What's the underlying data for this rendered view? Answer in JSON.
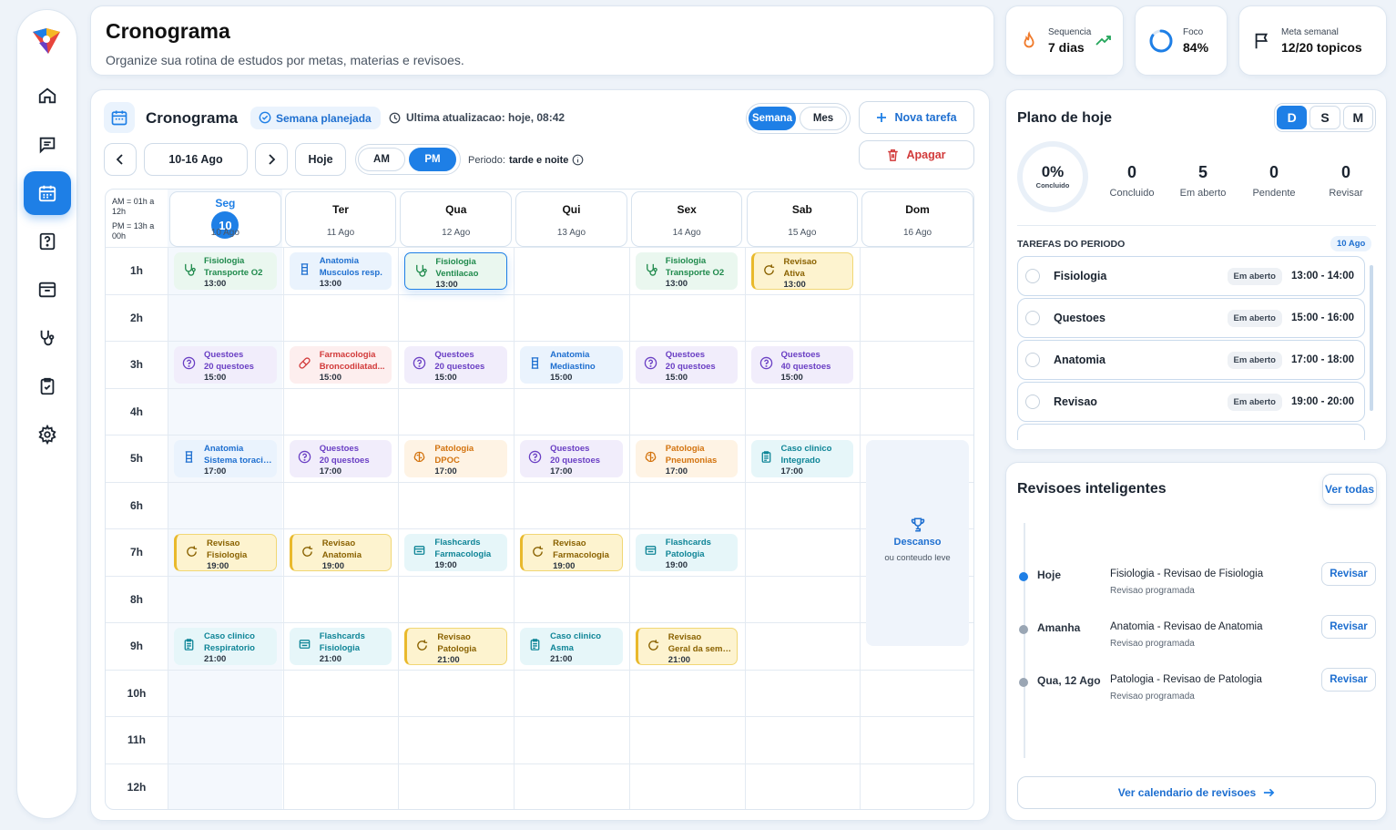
{
  "sidebar": {
    "items": [
      "home",
      "messages",
      "calendar",
      "questions",
      "inbox",
      "stethoscope",
      "checklist",
      "settings"
    ],
    "active": "calendar"
  },
  "header": {
    "title": "Cronograma",
    "subtitle": "Organize sua rotina de estudos por metas, materias e revisoes."
  },
  "stats": [
    {
      "label": "Sequencia",
      "value": "7 dias",
      "icon": "flame-icon"
    },
    {
      "label": "Foco",
      "value": "84%",
      "icon": "progress-ring-icon",
      "fraction": 0.84
    },
    {
      "label": "Meta semanal",
      "value": "12/20 topicos",
      "icon": "flag-icon"
    }
  ],
  "schedule": {
    "title": "Cronograma",
    "badge": "Semana planejada",
    "updated": "Ultima atualizacao: hoje, 08:42",
    "view_week": "Semana",
    "view_month": "Mes",
    "new_task": "Nova tarefa",
    "delete": "Apagar",
    "range": "10-16 Ago",
    "today": "Hoje",
    "am": "AM",
    "pm": "PM",
    "period_label": "Periodo:",
    "period_value": "tarde e noite",
    "legend_am": "AM = 01h a 12h",
    "legend_pm": "PM = 13h a 00h",
    "today_num": "10",
    "days": [
      {
        "name": "Seg",
        "date": "10 Ago"
      },
      {
        "name": "Ter",
        "date": "11 Ago"
      },
      {
        "name": "Qua",
        "date": "12 Ago"
      },
      {
        "name": "Qui",
        "date": "13 Ago"
      },
      {
        "name": "Sex",
        "date": "14 Ago"
      },
      {
        "name": "Sab",
        "date": "15 Ago"
      },
      {
        "name": "Dom",
        "date": "16 Ago"
      }
    ],
    "hours": [
      "1h",
      "2h",
      "3h",
      "4h",
      "5h",
      "6h",
      "7h",
      "8h",
      "9h",
      "10h",
      "11h",
      "12h"
    ],
    "events": [
      {
        "day": 0,
        "hour": 0,
        "title": "Fisiologia",
        "sub": "Transporte O2",
        "time": "13:00",
        "color": "green",
        "icon": "stethoscope-icon"
      },
      {
        "day": 1,
        "hour": 0,
        "title": "Anatomia",
        "sub": "Musculos resp.",
        "time": "13:00",
        "color": "blue",
        "icon": "anatomy-icon"
      },
      {
        "day": 2,
        "hour": 0,
        "title": "Fisiologia",
        "sub": "Ventilacao",
        "time": "13:00",
        "color": "green",
        "icon": "stethoscope-icon",
        "selected": true
      },
      {
        "day": 4,
        "hour": 0,
        "title": "Fisiologia",
        "sub": "Transporte O2",
        "time": "13:00",
        "color": "green",
        "icon": "stethoscope-icon"
      },
      {
        "day": 5,
        "hour": 0,
        "title": "Revisao",
        "sub": "Ativa",
        "time": "13:00",
        "color": "yellow",
        "icon": "refresh-icon"
      },
      {
        "day": 0,
        "hour": 2,
        "title": "Questoes",
        "sub": "20 questoes",
        "time": "15:00",
        "color": "purple",
        "icon": "question-icon"
      },
      {
        "day": 1,
        "hour": 2,
        "title": "Farmacologia",
        "sub": "Broncodilatad...",
        "time": "15:00",
        "color": "red",
        "icon": "pill-icon"
      },
      {
        "day": 2,
        "hour": 2,
        "title": "Questoes",
        "sub": "20 questoes",
        "time": "15:00",
        "color": "purple",
        "icon": "question-icon"
      },
      {
        "day": 3,
        "hour": 2,
        "title": "Anatomia",
        "sub": "Mediastino",
        "time": "15:00",
        "color": "blue",
        "icon": "anatomy-icon"
      },
      {
        "day": 4,
        "hour": 2,
        "title": "Questoes",
        "sub": "20 questoes",
        "time": "15:00",
        "color": "purple",
        "icon": "question-icon"
      },
      {
        "day": 5,
        "hour": 2,
        "title": "Questoes",
        "sub": "40 questoes",
        "time": "15:00",
        "color": "purple",
        "icon": "question-icon"
      },
      {
        "day": 0,
        "hour": 4,
        "title": "Anatomia",
        "sub": "Sistema toracico",
        "time": "17:00",
        "color": "blue",
        "icon": "anatomy-icon"
      },
      {
        "day": 1,
        "hour": 4,
        "title": "Questoes",
        "sub": "20 questoes",
        "time": "17:00",
        "color": "purple",
        "icon": "question-icon"
      },
      {
        "day": 2,
        "hour": 4,
        "title": "Patologia",
        "sub": "DPOC",
        "time": "17:00",
        "color": "orange",
        "icon": "brain-icon"
      },
      {
        "day": 3,
        "hour": 4,
        "title": "Questoes",
        "sub": "20 questoes",
        "time": "17:00",
        "color": "purple",
        "icon": "question-icon"
      },
      {
        "day": 4,
        "hour": 4,
        "title": "Patologia",
        "sub": "Pneumonias",
        "time": "17:00",
        "color": "orange",
        "icon": "brain-icon"
      },
      {
        "day": 5,
        "hour": 4,
        "title": "Caso clinico",
        "sub": "Integrado",
        "time": "17:00",
        "color": "teal",
        "icon": "clipboard-icon"
      },
      {
        "day": 0,
        "hour": 6,
        "title": "Revisao",
        "sub": "Fisiologia",
        "time": "19:00",
        "color": "yellow",
        "icon": "refresh-icon"
      },
      {
        "day": 1,
        "hour": 6,
        "title": "Revisao",
        "sub": "Anatomia",
        "time": "19:00",
        "color": "yellow",
        "icon": "refresh-icon"
      },
      {
        "day": 2,
        "hour": 6,
        "title": "Flashcards",
        "sub": "Farmacologia",
        "time": "19:00",
        "color": "teal",
        "icon": "cards-icon"
      },
      {
        "day": 3,
        "hour": 6,
        "title": "Revisao",
        "sub": "Farmacologia",
        "time": "19:00",
        "color": "yellow",
        "icon": "refresh-icon"
      },
      {
        "day": 4,
        "hour": 6,
        "title": "Flashcards",
        "sub": "Patologia",
        "time": "19:00",
        "color": "teal",
        "icon": "cards-icon"
      },
      {
        "day": 0,
        "hour": 8,
        "title": "Caso clinico",
        "sub": "Respiratorio",
        "time": "21:00",
        "color": "teal",
        "icon": "clipboard-icon"
      },
      {
        "day": 1,
        "hour": 8,
        "title": "Flashcards",
        "sub": "Fisiologia",
        "time": "21:00",
        "color": "teal",
        "icon": "cards-icon"
      },
      {
        "day": 2,
        "hour": 8,
        "title": "Revisao",
        "sub": "Patologia",
        "time": "21:00",
        "color": "yellow",
        "icon": "refresh-icon"
      },
      {
        "day": 3,
        "hour": 8,
        "title": "Caso clinico",
        "sub": "Asma",
        "time": "21:00",
        "color": "teal",
        "icon": "clipboard-icon"
      },
      {
        "day": 4,
        "hour": 8,
        "title": "Revisao",
        "sub": "Geral da semana",
        "time": "21:00",
        "color": "yellow",
        "icon": "refresh-icon"
      }
    ],
    "rest": {
      "title": "Descanso",
      "sub": "ou conteudo leve"
    }
  },
  "plan": {
    "title": "Plano de hoje",
    "toggles": [
      "D",
      "S",
      "M"
    ],
    "active_toggle": "D",
    "percent": "0%",
    "percent_label": "Concluido",
    "kpis": [
      {
        "n": "0",
        "l": "Concluido"
      },
      {
        "n": "5",
        "l": "Em aberto"
      },
      {
        "n": "0",
        "l": "Pendente"
      },
      {
        "n": "0",
        "l": "Revisar"
      }
    ],
    "section": "TAREFAS DO PERIODO",
    "section_date": "10 Ago",
    "tasks": [
      {
        "name": "Fisiologia",
        "status": "Em aberto",
        "time": "13:00 - 14:00"
      },
      {
        "name": "Questoes",
        "status": "Em aberto",
        "time": "15:00 - 16:00"
      },
      {
        "name": "Anatomia",
        "status": "Em aberto",
        "time": "17:00 - 18:00"
      },
      {
        "name": "Revisao",
        "status": "Em aberto",
        "time": "19:00 - 20:00"
      }
    ]
  },
  "reviews": {
    "title": "Revisoes inteligentes",
    "see_all": "Ver todas",
    "items": [
      {
        "when": "Hoje",
        "title": "Fisiologia - Revisao de Fisiologia",
        "sub": "Revisao programada",
        "btn": "Revisar",
        "active": true
      },
      {
        "when": "Amanha",
        "title": "Anatomia - Revisao de Anatomia",
        "sub": "Revisao programada",
        "btn": "Revisar",
        "active": false
      },
      {
        "when": "Qua, 12 Ago",
        "title": "Patologia - Revisao de Patologia",
        "sub": "Revisao programada",
        "btn": "Revisar",
        "active": false
      }
    ],
    "calendar_link": "Ver calendario de revisoes"
  }
}
